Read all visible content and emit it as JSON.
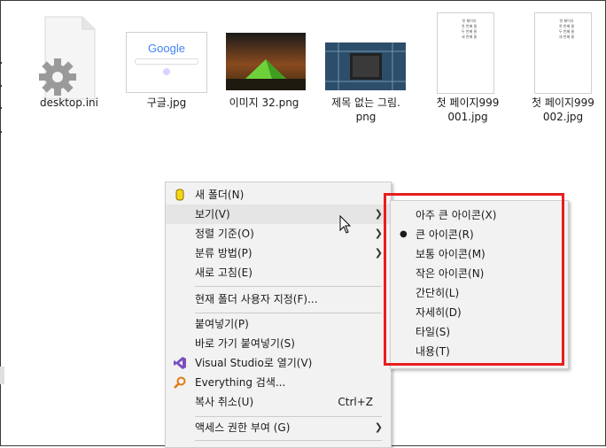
{
  "files": [
    {
      "name": "desktop.ini",
      "type": "settings-file"
    },
    {
      "name": "구글.jpg",
      "type": "image"
    },
    {
      "name": "이미지 32.png",
      "type": "image"
    },
    {
      "name": "제목 없는 그림.png",
      "line1": "제목 없는 그림.",
      "line2": "png",
      "type": "image"
    },
    {
      "name": "첫 페이지999001.jpg",
      "line1": "첫 페이지999",
      "line2": "001.jpg",
      "type": "image"
    },
    {
      "name": "첫 페이지999002.jpg",
      "line1": "첫 페이지999",
      "line2": "002.jpg",
      "type": "image"
    }
  ],
  "context_menu": {
    "items": [
      {
        "label": "새 폴더(N)",
        "icon": "new-folder-icon"
      },
      {
        "label": "보기(V)",
        "submenu": true,
        "hovered": true
      },
      {
        "label": "정렬 기준(O)",
        "submenu": true
      },
      {
        "label": "분류 방법(P)",
        "submenu": true
      },
      {
        "label": "새로 고침(E)"
      },
      {
        "label": "현재 폴더 사용자 지정(F)..."
      },
      {
        "label": "붙여넣기(P)"
      },
      {
        "label": "바로 가기 붙여넣기(S)"
      },
      {
        "label": "Visual Studio로 열기(V)",
        "icon": "visual-studio-icon"
      },
      {
        "label": "Everything 검색...",
        "icon": "everything-search-icon"
      },
      {
        "label": "복사 취소(U)",
        "shortcut": "Ctrl+Z"
      },
      {
        "label": "액세스 권한 부여 (G)",
        "submenu": true
      }
    ]
  },
  "view_submenu": {
    "items": [
      {
        "label": "아주 큰 아이콘(X)"
      },
      {
        "label": "큰 아이콘(R)",
        "selected": true,
        "bullet": "●"
      },
      {
        "label": "보통 아이콘(M)"
      },
      {
        "label": "작은 아이콘(N)"
      },
      {
        "label": "간단히(L)"
      },
      {
        "label": "자세히(D)"
      },
      {
        "label": "타일(S)"
      },
      {
        "label": "내용(T)"
      }
    ],
    "highlight_color": "#e81e1e"
  },
  "thumbnail_text": {
    "google_logo": "Google",
    "doc_lines": [
      "첫 페이지",
      "첫 번째 줄",
      "두 번째 줄",
      "세 번째 줄"
    ]
  },
  "colors": {
    "menu_bg": "#f2f2f2",
    "hover_bg": "#e5e5e5",
    "separator": "#cccccc"
  }
}
